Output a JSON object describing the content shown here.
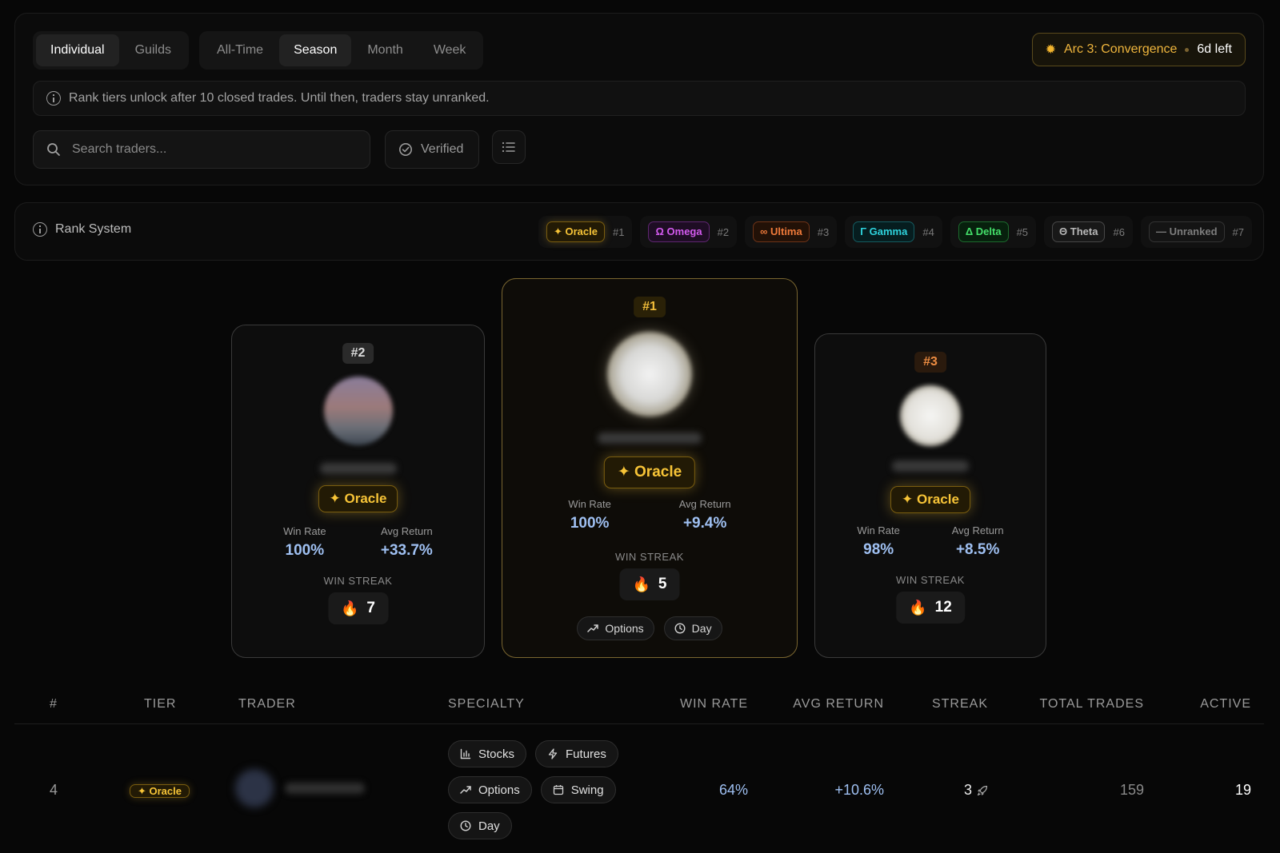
{
  "tabs_view": [
    "Individual",
    "Guilds"
  ],
  "tabs_period": [
    "All-Time",
    "Season",
    "Month",
    "Week"
  ],
  "active_view": "Individual",
  "active_period": "Season",
  "season": {
    "icon": "sun-icon",
    "name": "Arc 3: Convergence",
    "time_left": "6d left"
  },
  "info_text": "Rank tiers unlock after 10 closed trades. Until then, traders stay unranked.",
  "search": {
    "placeholder": "Search traders..."
  },
  "verified_label": "Verified",
  "rank_system": {
    "title": "Rank System",
    "tiers": [
      {
        "symbol": "✦",
        "name": "Oracle",
        "rank": "#1",
        "color": "#f7c437"
      },
      {
        "symbol": "Ω",
        "name": "Omega",
        "rank": "#2",
        "color": "#d45bf0"
      },
      {
        "symbol": "∞",
        "name": "Ultima",
        "rank": "#3",
        "color": "#f07a3a"
      },
      {
        "symbol": "Γ",
        "name": "Gamma",
        "rank": "#4",
        "color": "#2ed3dd"
      },
      {
        "symbol": "Δ",
        "name": "Delta",
        "rank": "#5",
        "color": "#44e06a"
      },
      {
        "symbol": "Θ",
        "name": "Theta",
        "rank": "#6",
        "color": "#b9b9b9"
      },
      {
        "symbol": "—",
        "name": "Unranked",
        "rank": "#7",
        "color": "#7d7d7d"
      }
    ]
  },
  "podium": {
    "first": {
      "position": "#1",
      "tier": "✦ Oracle",
      "win_rate_label": "Win Rate",
      "win_rate": "100%",
      "avg_return_label": "Avg Return",
      "avg_return": "+9.4%",
      "streak_label": "WIN STREAK",
      "streak": "5",
      "tags": [
        "Options",
        "Day"
      ]
    },
    "second": {
      "position": "#2",
      "tier": "✦ Oracle",
      "win_rate_label": "Win Rate",
      "win_rate": "100%",
      "avg_return_label": "Avg Return",
      "avg_return": "+33.7%",
      "streak_label": "WIN STREAK",
      "streak": "7"
    },
    "third": {
      "position": "#3",
      "tier": "✦ Oracle",
      "win_rate_label": "Win Rate",
      "win_rate": "98%",
      "avg_return_label": "Avg Return",
      "avg_return": "+8.5%",
      "streak_label": "WIN STREAK",
      "streak": "12"
    }
  },
  "table": {
    "headers": [
      "#",
      "TIER",
      "TRADER",
      "SPECIALTY",
      "WIN RATE",
      "AVG RETURN",
      "STREAK",
      "TOTAL TRADES",
      "ACTIVE"
    ],
    "rows": [
      {
        "rank": "4",
        "tier": "✦ Oracle",
        "specialties": [
          "Stocks",
          "Futures",
          "Options",
          "Swing",
          "Day"
        ],
        "win_rate": "64%",
        "avg_return": "+10.6%",
        "streak": "3",
        "total_trades": "159",
        "active": "19"
      }
    ]
  }
}
